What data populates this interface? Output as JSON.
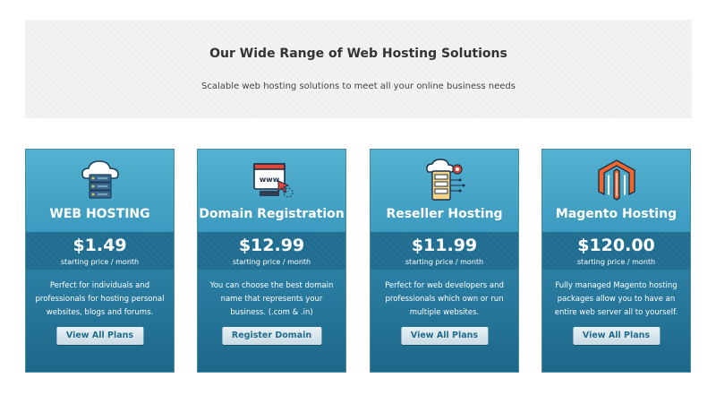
{
  "hero": {
    "title": "Our Wide Range of Web Hosting Solutions",
    "subtitle": "Scalable web hosting solutions to meet all your online business needs"
  },
  "plans": [
    {
      "icon": "cloud-server-icon",
      "title": "WEB HOSTING",
      "price": "$1.49",
      "price_note": "starting price / month",
      "description": "Perfect for individuals and professionals for hosting personal websites, blogs and forums.",
      "button": "View All Plans"
    },
    {
      "icon": "www-browser-icon",
      "title": "Domain Registration",
      "price": "$12.99",
      "price_note": "starting price / month",
      "description": "You can choose the best domain name that represents your business. (.com & .in)",
      "button": "Register Domain"
    },
    {
      "icon": "reseller-server-icon",
      "title": "Reseller Hosting",
      "price": "$11.99",
      "price_note": "starting price / month",
      "description": "Perfect for web developers and professionals which own or run multiple websites.",
      "button": "View All Plans"
    },
    {
      "icon": "magento-logo-icon",
      "title": "Magento Hosting",
      "price": "$120.00",
      "price_note": "starting price / month",
      "description": "Fully managed Magento hosting packages allow you to have an entire web server all to yourself.",
      "button": "View All Plans"
    }
  ],
  "colors": {
    "card_top": "#54b1d0",
    "card_bottom": "#1d6789",
    "button_text": "#1f6d90",
    "magento_orange": "#ee672f"
  }
}
